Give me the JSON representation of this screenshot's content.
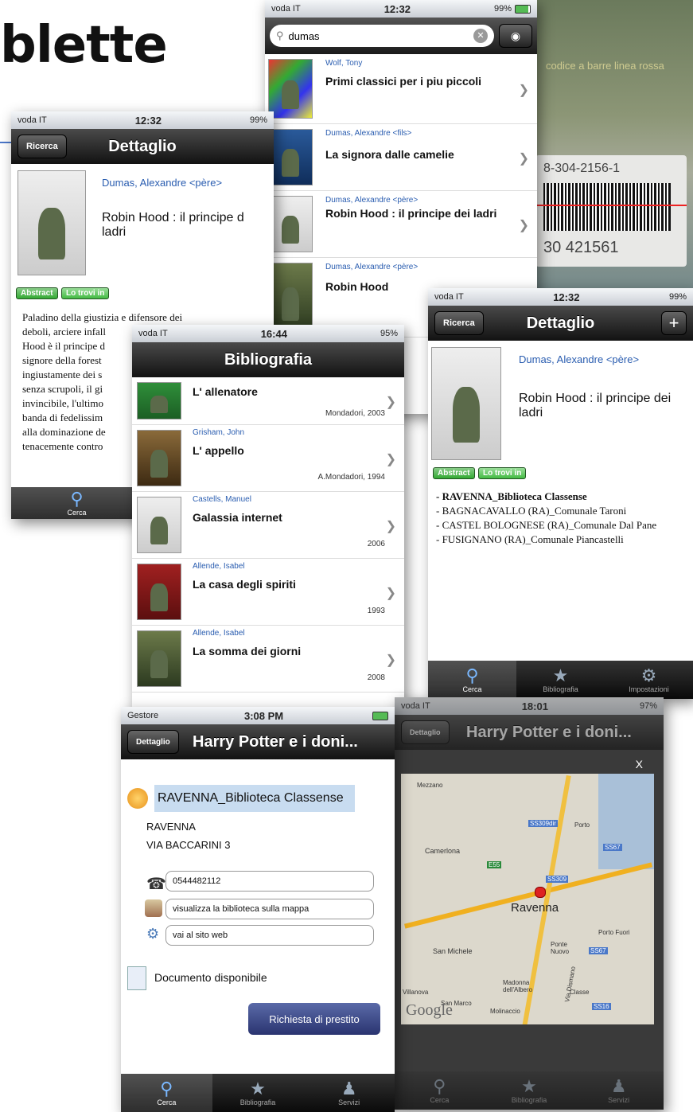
{
  "slide": {
    "title": "blette"
  },
  "status": {
    "carrier": "voda IT",
    "carrier_gestore": "Gestore",
    "time_1232": "12:32",
    "time_1644": "16:44",
    "time_308": "3:08 PM",
    "time_1801": "18:01",
    "battery_99": "99%",
    "battery_95": "95%",
    "battery_97": "97%"
  },
  "tabs": {
    "cerca": "Cerca",
    "bibliografia": "Bibliografia",
    "impostazioni": "Impostazioni",
    "servizi": "Servizi"
  },
  "search_screen": {
    "query": "dumas",
    "results": [
      {
        "author": "Wolf, Tony",
        "title": "Primi classici per i piu piccoli"
      },
      {
        "author": "Dumas, Alexandre <fils>",
        "title": "La signora dalle camelie"
      },
      {
        "author": "Dumas, Alexandre <père>",
        "title": "Robin Hood : il principe dei ladri"
      },
      {
        "author": "Dumas, Alexandre <père>",
        "title": "Robin Hood"
      }
    ]
  },
  "barcode": {
    "overlay_text": "codice a barre linea rossa",
    "digits_top": "8-304-2156-1",
    "digits_bottom": "30 421561"
  },
  "detail_left": {
    "back": "Ricerca",
    "nav_title": "Dettaglio",
    "author": "Dumas, Alexandre <père>",
    "title": "Robin Hood : il principe d ladri",
    "abstract_btn": "Abstract",
    "find_btn": "Lo trovi in",
    "abstract_lines": [
      "Paladino della giustizia e difensore dei",
      "deboli, arciere infall",
      "Hood è il principe d",
      "signore della forest",
      "ingiustamente dei s",
      "senza scrupoli, il gi",
      "invincibile, l'ultimo",
      "banda di fedelissim",
      "alla dominazione de",
      "tenacemente contro"
    ]
  },
  "detail_right": {
    "back": "Ricerca",
    "nav_title": "Dettaglio",
    "author": "Dumas, Alexandre <père>",
    "title": "Robin Hood : il principe dei ladri",
    "abstract_btn": "Abstract",
    "find_btn": "Lo trovi in",
    "libraries": [
      "- RAVENNA_Biblioteca Classense",
      "- BAGNACAVALLO (RA)_Comunale Taroni",
      "- CASTEL BOLOGNESE (RA)_Comunale Dal Pane",
      "- FUSIGNANO (RA)_Comunale Piancastelli"
    ]
  },
  "bibliografia": {
    "nav_title": "Bibliografia",
    "items": [
      {
        "author": "",
        "title": "L' allenatore",
        "pub": "Mondadori, 2003"
      },
      {
        "author": "Grisham, John",
        "title": "L' appello",
        "pub": "A.Mondadori, 1994"
      },
      {
        "author": "Castells, Manuel",
        "title": "Galassia internet",
        "pub": "2006"
      },
      {
        "author": "Allende, Isabel",
        "title": "La casa degli spiriti",
        "pub": "1993"
      },
      {
        "author": "Allende, Isabel",
        "title": "La somma dei giorni",
        "pub": "2008"
      }
    ]
  },
  "library_screen": {
    "back": "Dettaglio",
    "nav_title": "Harry Potter e i doni...",
    "name": "RAVENNA_Biblioteca Classense",
    "city": "RAVENNA",
    "address": "VIA BACCARINI 3",
    "phone": "0544482112",
    "map_link": "visualizza la biblioteca sulla mappa",
    "web_link": "vai al sito web",
    "available": "Documento disponibile",
    "loan_btn": "Richiesta di prestito"
  },
  "map_screen": {
    "back": "Dettaglio",
    "nav_title": "Harry Potter e i doni...",
    "close": "X",
    "labels": [
      "Camerlona",
      "Ravenna",
      "San Michele",
      "Ponte Nuovo",
      "Porto Fuori",
      "Madonna dell'Albero",
      "Classe",
      "San Marco",
      "Molinaccio",
      "Mezzano",
      "Porto",
      "Villanova",
      "Via Dismano"
    ],
    "road_labels": [
      "SS309dir",
      "SS67",
      "E55",
      "SS309",
      "SS67",
      "SS16"
    ],
    "brand": "Google"
  }
}
